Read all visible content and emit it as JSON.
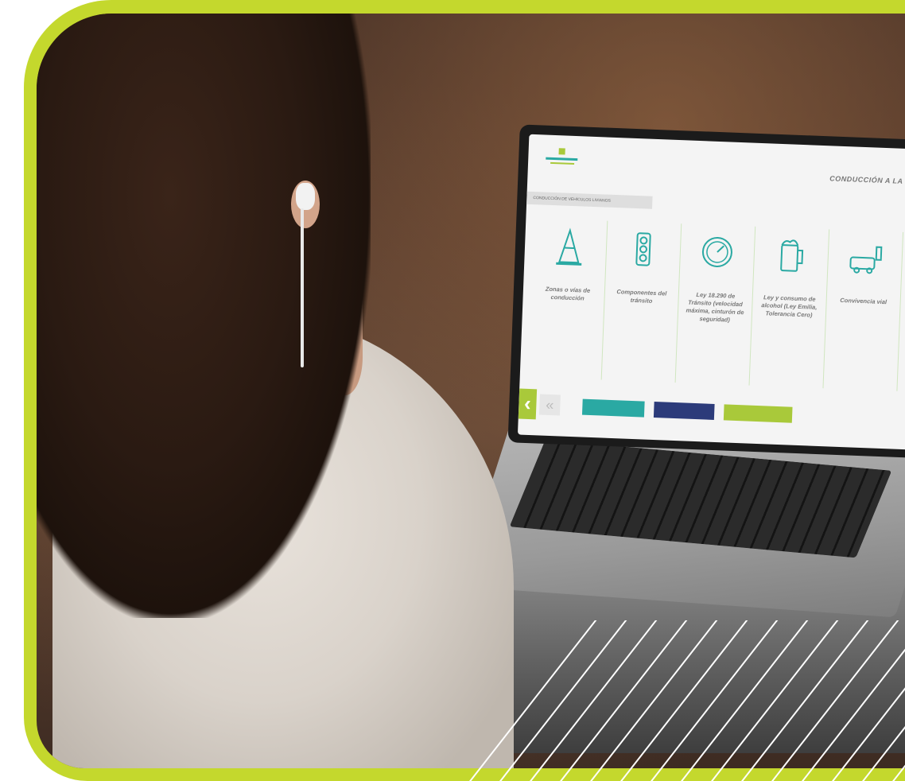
{
  "brand": {
    "accent": "#c4d82d",
    "teal": "#2aa9a3",
    "navy": "#2c3b7a",
    "lime": "#a9c93a"
  },
  "screen": {
    "title": "CONDUCCIÓN A LA DEFENSIVA",
    "section_label": "CONDUCCIÓN DE VEHÍCULOS LIVIANOS",
    "cards": [
      {
        "icon": "traffic-cone-icon",
        "label": "Zonas o vías de conducción"
      },
      {
        "icon": "traffic-light-icon",
        "label": "Componentes del tránsito"
      },
      {
        "icon": "speedometer-icon",
        "label": "Ley 18.290 de Tránsito (velocidad máxima, cinturón de seguridad)"
      },
      {
        "icon": "beer-mug-icon",
        "label": "Ley y consumo de alcohol (Ley Emilia, Tolerancia Cero)"
      },
      {
        "icon": "road-scene-icon",
        "label": "Convivencia vial"
      }
    ],
    "nav": {
      "prev_icon": "chevron-left-icon",
      "next_icon": "chevron-right-icon",
      "btn_teal": "",
      "btn_navy": "",
      "btn_lime": ""
    }
  }
}
